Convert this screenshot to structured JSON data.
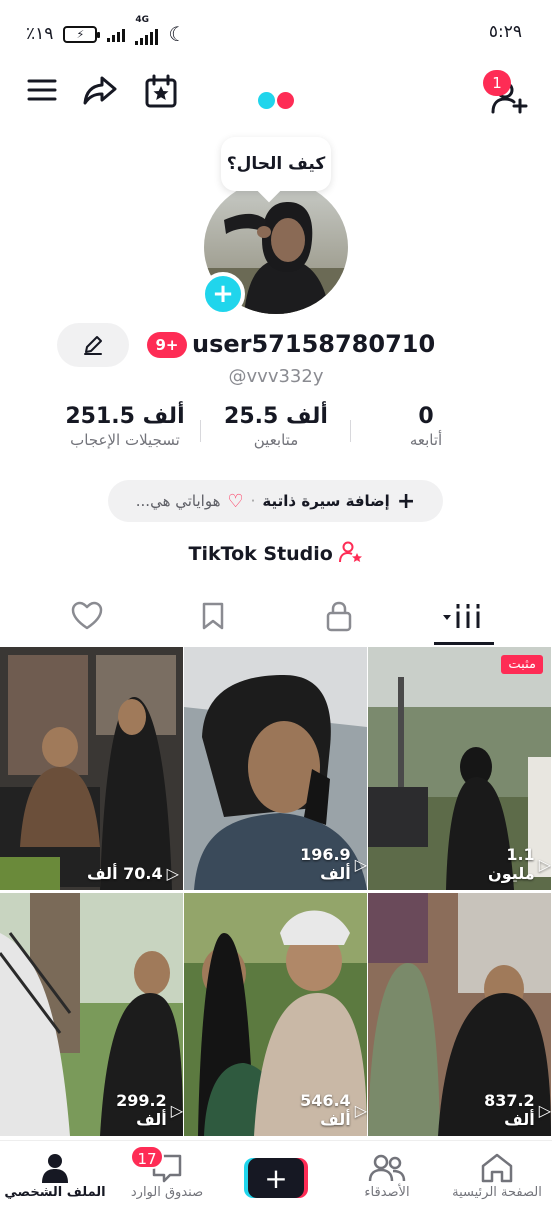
{
  "status_bar": {
    "battery_percent": "٪١٩",
    "network": "4G",
    "time": "٥:٢٩"
  },
  "top_nav": {
    "friend_requests_badge": "1"
  },
  "profile": {
    "status_bubble": "كيف الحال؟",
    "username": "user57158780710",
    "notification_badge": "9+",
    "handle": "@vvv332y",
    "stats": {
      "following": {
        "value": "0",
        "label": "أتابعه"
      },
      "followers": {
        "value": "25.5 ألف",
        "label": "متابعين"
      },
      "likes": {
        "value": "251.5 ألف",
        "label": "تسجيلات الإعجاب"
      }
    },
    "bio_add": "إضافة سيرة ذاتية",
    "bio_hobbies": "هواياتي هي...",
    "studio_label": "TikTok Studio"
  },
  "grid": {
    "pinned_label": "مثبت",
    "videos": [
      {
        "views": "1.1 مليون",
        "pinned": true
      },
      {
        "views": "196.9 ألف",
        "pinned": false
      },
      {
        "views": "70.4 ألف",
        "pinned": false
      },
      {
        "views": "837.2 ألف",
        "pinned": false
      },
      {
        "views": "546.4 ألف",
        "pinned": false
      },
      {
        "views": "299.2 ألف",
        "pinned": false
      }
    ]
  },
  "bottom_nav": {
    "home": "الصفحة الرئيسية",
    "friends": "الأصدقاء",
    "inbox": "صندوق الوارد",
    "inbox_badge": "17",
    "profile": "الملف الشخصي"
  },
  "colors": {
    "accent_red": "#fe2c55",
    "accent_cyan": "#20d5ec",
    "text": "#161823"
  }
}
